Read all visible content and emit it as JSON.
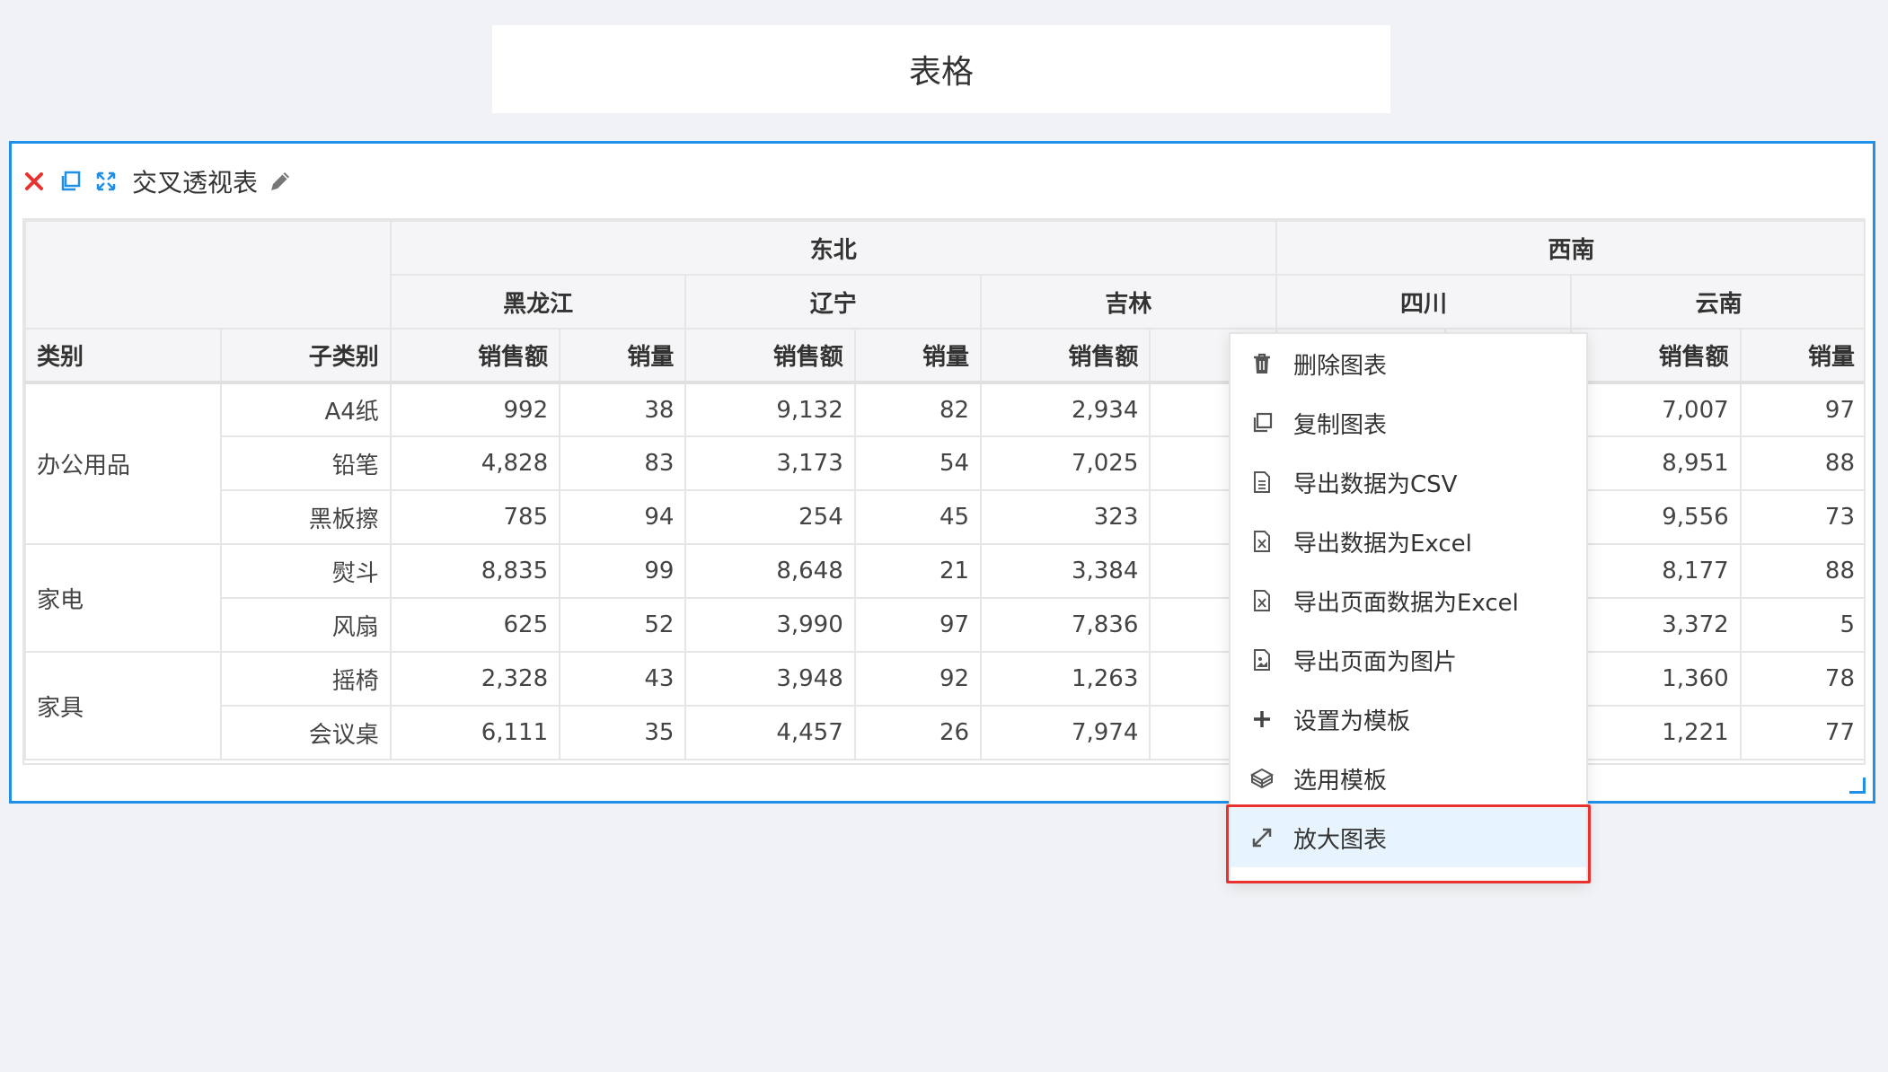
{
  "page": {
    "title": "表格"
  },
  "widget": {
    "title": "交叉透视表"
  },
  "table": {
    "regions": [
      "东北",
      "西南"
    ],
    "provinces": [
      "黑龙江",
      "辽宁",
      "吉林",
      "四川",
      "云南"
    ],
    "row_headers": [
      "类别",
      "子类别"
    ],
    "measures": [
      "销售额",
      "销量",
      "销售额",
      "销量",
      "销售额",
      "销",
      "销售额",
      "销量"
    ],
    "categories": [
      "办公用品",
      "家电",
      "家具"
    ],
    "rows": [
      {
        "sub": "A4纸",
        "cells": [
          "992",
          "38",
          "9,132",
          "82",
          "2,934",
          "",
          "7,007",
          "97"
        ]
      },
      {
        "sub": "铅笔",
        "cells": [
          "4,828",
          "83",
          "3,173",
          "54",
          "7,025",
          "",
          "8,951",
          "88"
        ]
      },
      {
        "sub": "黑板擦",
        "cells": [
          "785",
          "94",
          "254",
          "45",
          "323",
          "",
          "9,556",
          "73"
        ]
      },
      {
        "sub": "熨斗",
        "cells": [
          "8,835",
          "99",
          "8,648",
          "21",
          "3,384",
          "",
          "8,177",
          "88"
        ]
      },
      {
        "sub": "风扇",
        "cells": [
          "625",
          "52",
          "3,990",
          "97",
          "7,836",
          "",
          "3,372",
          "5"
        ]
      },
      {
        "sub": "摇椅",
        "cells": [
          "2,328",
          "43",
          "3,948",
          "92",
          "1,263",
          "",
          "1,360",
          "78"
        ]
      },
      {
        "sub": "会议桌",
        "cells": [
          "6,111",
          "35",
          "4,457",
          "26",
          "7,974",
          "",
          "1,221",
          "77"
        ]
      }
    ]
  },
  "context_menu": {
    "items": [
      {
        "label": "删除图表",
        "icon": "trash-icon"
      },
      {
        "label": "复制图表",
        "icon": "copy-icon"
      },
      {
        "label": "导出数据为CSV",
        "icon": "file-icon"
      },
      {
        "label": "导出数据为Excel",
        "icon": "excel-file-icon"
      },
      {
        "label": "导出页面数据为Excel",
        "icon": "excel-file-icon"
      },
      {
        "label": "导出页面为图片",
        "icon": "image-file-icon"
      },
      {
        "label": "设置为模板",
        "icon": "plus-icon"
      },
      {
        "label": "选用模板",
        "icon": "template-icon"
      },
      {
        "label": "放大图表",
        "icon": "expand-icon"
      }
    ]
  },
  "colors": {
    "accent": "#1e90ea",
    "close": "#e8322f",
    "highlight_border": "#e8322f"
  }
}
